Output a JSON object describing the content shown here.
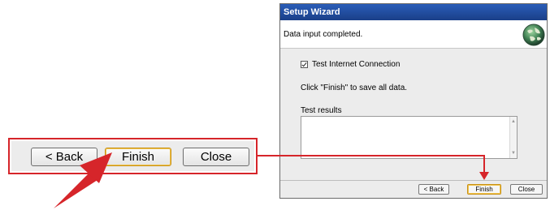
{
  "wizard": {
    "title": "Setup Wizard",
    "header_message": "Data input completed.",
    "checkbox_label": "Test Internet Connection",
    "checkbox_checked": true,
    "save_note": "Click \"Finish\" to save all data.",
    "results_label": "Test results",
    "results_value": "",
    "buttons": {
      "back": "< Back",
      "finish": "Finish",
      "close": "Close"
    }
  },
  "zoom": {
    "buttons": {
      "back": "< Back",
      "finish": "Finish",
      "close": "Close"
    }
  },
  "colors": {
    "callout": "#d6252a",
    "titlebar": "#2a5db8",
    "finish_highlight": "#f0c24a"
  }
}
